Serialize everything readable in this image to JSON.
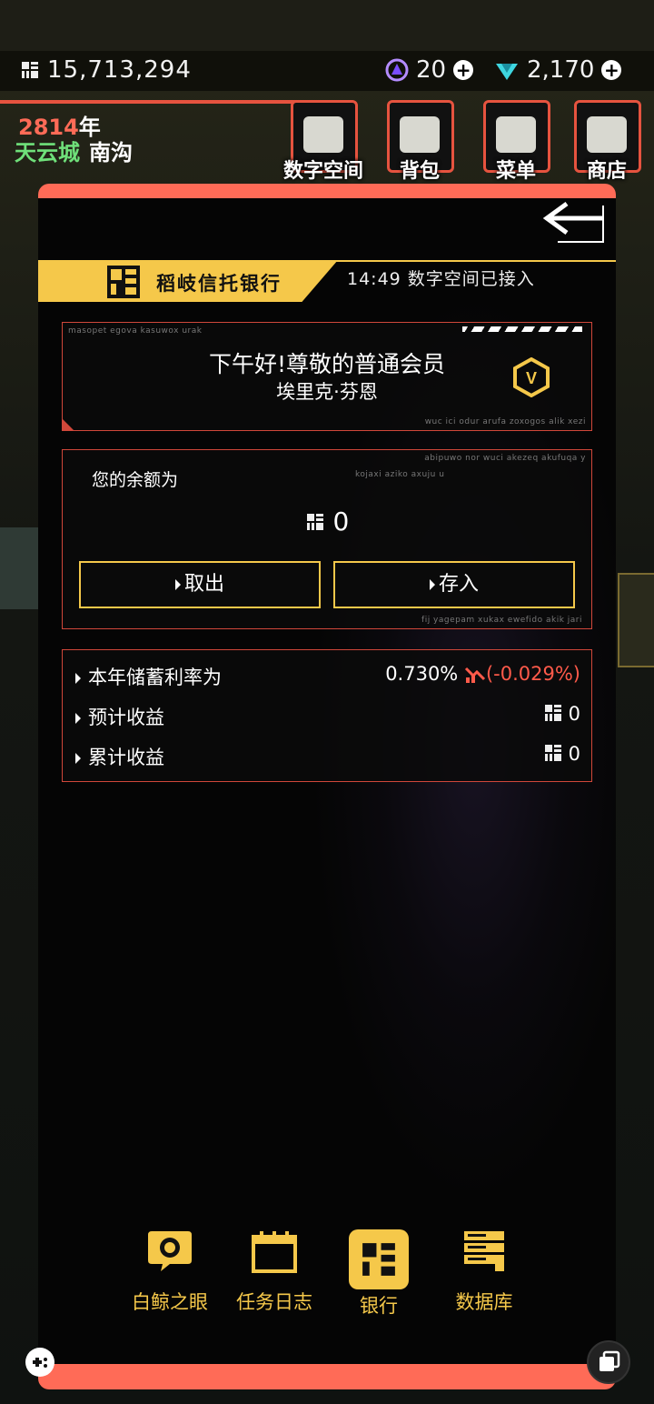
{
  "hud": {
    "coins": "15,713,294",
    "gems_purple": "20",
    "gems_cyan": "2,170",
    "year_num": "2814",
    "year_unit": "年",
    "city": "天云城",
    "district": "南沟"
  },
  "menu": [
    {
      "label": "数字空间",
      "icon": "layers-icon"
    },
    {
      "label": "背包",
      "icon": "bag-icon"
    },
    {
      "label": "菜单",
      "icon": "list-icon"
    },
    {
      "label": "商店",
      "icon": "cart-icon"
    }
  ],
  "bank": {
    "name": "稻岐信托银行",
    "status": "14:49 数字空间已接入"
  },
  "greeting": {
    "line1": "下午好!尊敬的普通会员",
    "line2": "埃里克·芬恩",
    "micro_top": "masopet egova kasuwox urak",
    "micro_bottom": "wuc ici odur arufa zoxogos alik xezi"
  },
  "balance": {
    "label": "您的余额为",
    "value": "0",
    "withdraw": "取出",
    "deposit": "存入",
    "micro_top1": "abipuwo nor wuci akezeq akufuqa y",
    "micro_top2": "kojaxi aziko axuju u",
    "micro_bottom": "fij yagepam xukax ewefido akik jari"
  },
  "stats": [
    {
      "label": "本年储蓄利率为",
      "value": "0.730%",
      "delta": "(-0.029%)"
    },
    {
      "label": "预计收益",
      "value": "0"
    },
    {
      "label": "累计收益",
      "value": "0"
    }
  ],
  "nav": [
    {
      "label": "白鲸之眼",
      "icon": "eye-icon"
    },
    {
      "label": "任务日志",
      "icon": "calendar-icon"
    },
    {
      "label": "银行",
      "icon": "bank-icon",
      "active": true
    },
    {
      "label": "数据库",
      "icon": "database-icon"
    }
  ],
  "colors": {
    "accent": "#ff6b57",
    "yellow": "#f5c84a",
    "green": "#6fe07a",
    "negative": "#ff5a4a"
  }
}
